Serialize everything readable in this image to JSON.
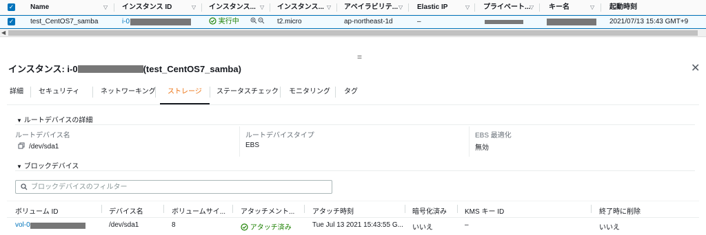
{
  "top_table": {
    "headers": {
      "name": "Name",
      "instance_id": "インスタンス ID",
      "instance_state": "インスタンス...",
      "instance_type": "インスタンス...",
      "availability": "アベイラビリテ...",
      "elastic_ip": "Elastic IP",
      "private": "プライベート...",
      "key_name": "キー名",
      "launch_time": "起動時刻"
    },
    "row": {
      "name": "test_CentOS7_samba",
      "instance_id_prefix": "i-0",
      "state": "実行中",
      "type": "t2.micro",
      "zone": "ap-northeast-1d",
      "elastic_ip": "–",
      "launch_time": "2021/07/13 15:43 GMT+9"
    }
  },
  "panel": {
    "title_prefix": "インスタンス: i-0",
    "title_suffix": "(test_CentOS7_samba)",
    "tabs": [
      "詳細",
      "セキュリティ",
      "ネットワーキング",
      "ストレージ",
      "ステータスチェック",
      "モニタリング",
      "タグ"
    ],
    "root_section": "ルートデバイスの詳細",
    "root_fields": [
      {
        "label": "ルートデバイス名",
        "value": "/dev/sda1"
      },
      {
        "label": "ルートデバイスタイプ",
        "value": "EBS"
      },
      {
        "label": "EBS 最適化",
        "value": "無効"
      }
    ],
    "block_section": "ブロックデバイス",
    "filter_placeholder": "ブロックデバイスのフィルター",
    "block_headers": [
      "ボリューム ID",
      "デバイス名",
      "ボリュームサイ...",
      "アタッチメント...",
      "アタッチ時刻",
      "暗号化済み",
      "KMS キー ID",
      "終了時に削除"
    ],
    "block_row": {
      "volume_prefix": "vol-0",
      "device": "/dev/sda1",
      "size": "8",
      "attach_status": "アタッチ済み",
      "attach_time": "Tue Jul 13 2021 15:43:55 G...",
      "encrypted": "いいえ",
      "kms": "–",
      "delete_on_term": "いいえ"
    }
  },
  "icons": {
    "running": "check-circle-icon",
    "zoom": "zoom-icons",
    "close": "close-icon",
    "search": "search-icon",
    "copy": "copy-icon"
  }
}
